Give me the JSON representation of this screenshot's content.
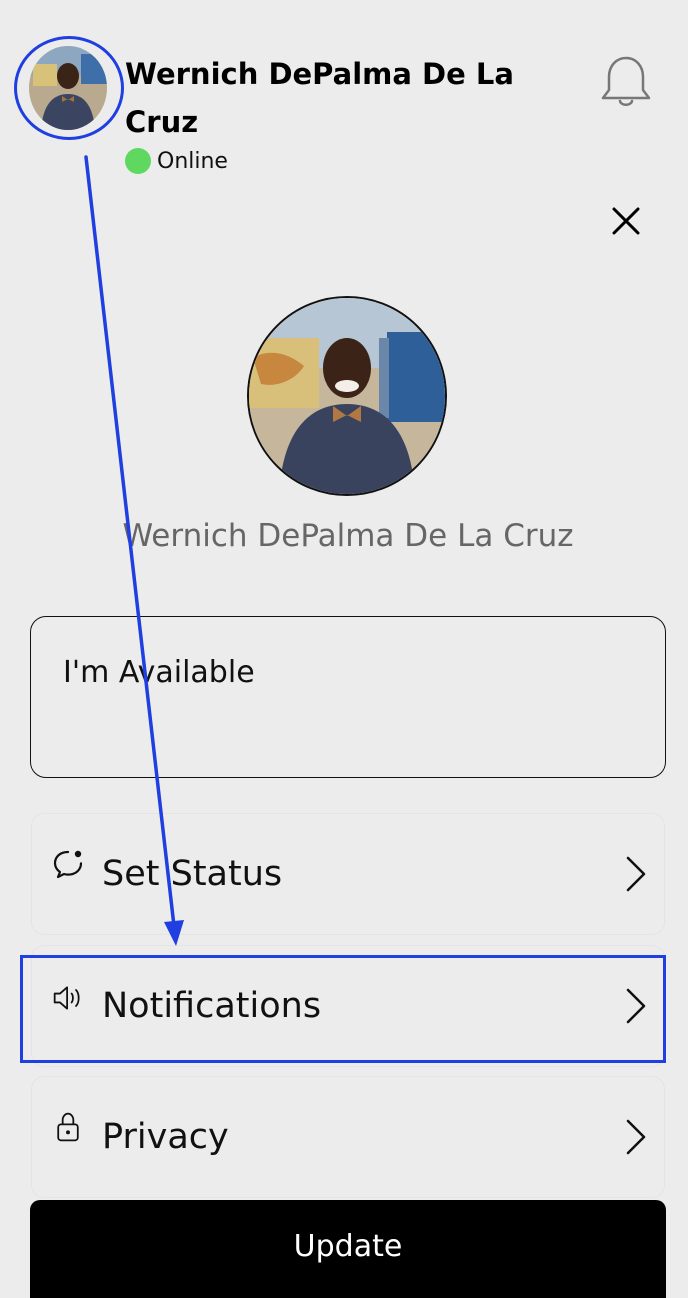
{
  "header": {
    "user_name": "Wernich DePalma De La Cruz",
    "presence": "Online",
    "presence_color": "#5ed85e"
  },
  "profile": {
    "display_name": "Wernich DePalma De La Cruz"
  },
  "status_message": {
    "value": "I'm Available"
  },
  "menu": [
    {
      "label": "Set Status",
      "icon": "chat-status-icon"
    },
    {
      "label": "Notifications",
      "icon": "speaker-icon"
    },
    {
      "label": "Privacy",
      "icon": "lock-icon"
    }
  ],
  "actions": {
    "update_label": "Update"
  },
  "annotation": {
    "color": "#1f3fe0"
  }
}
